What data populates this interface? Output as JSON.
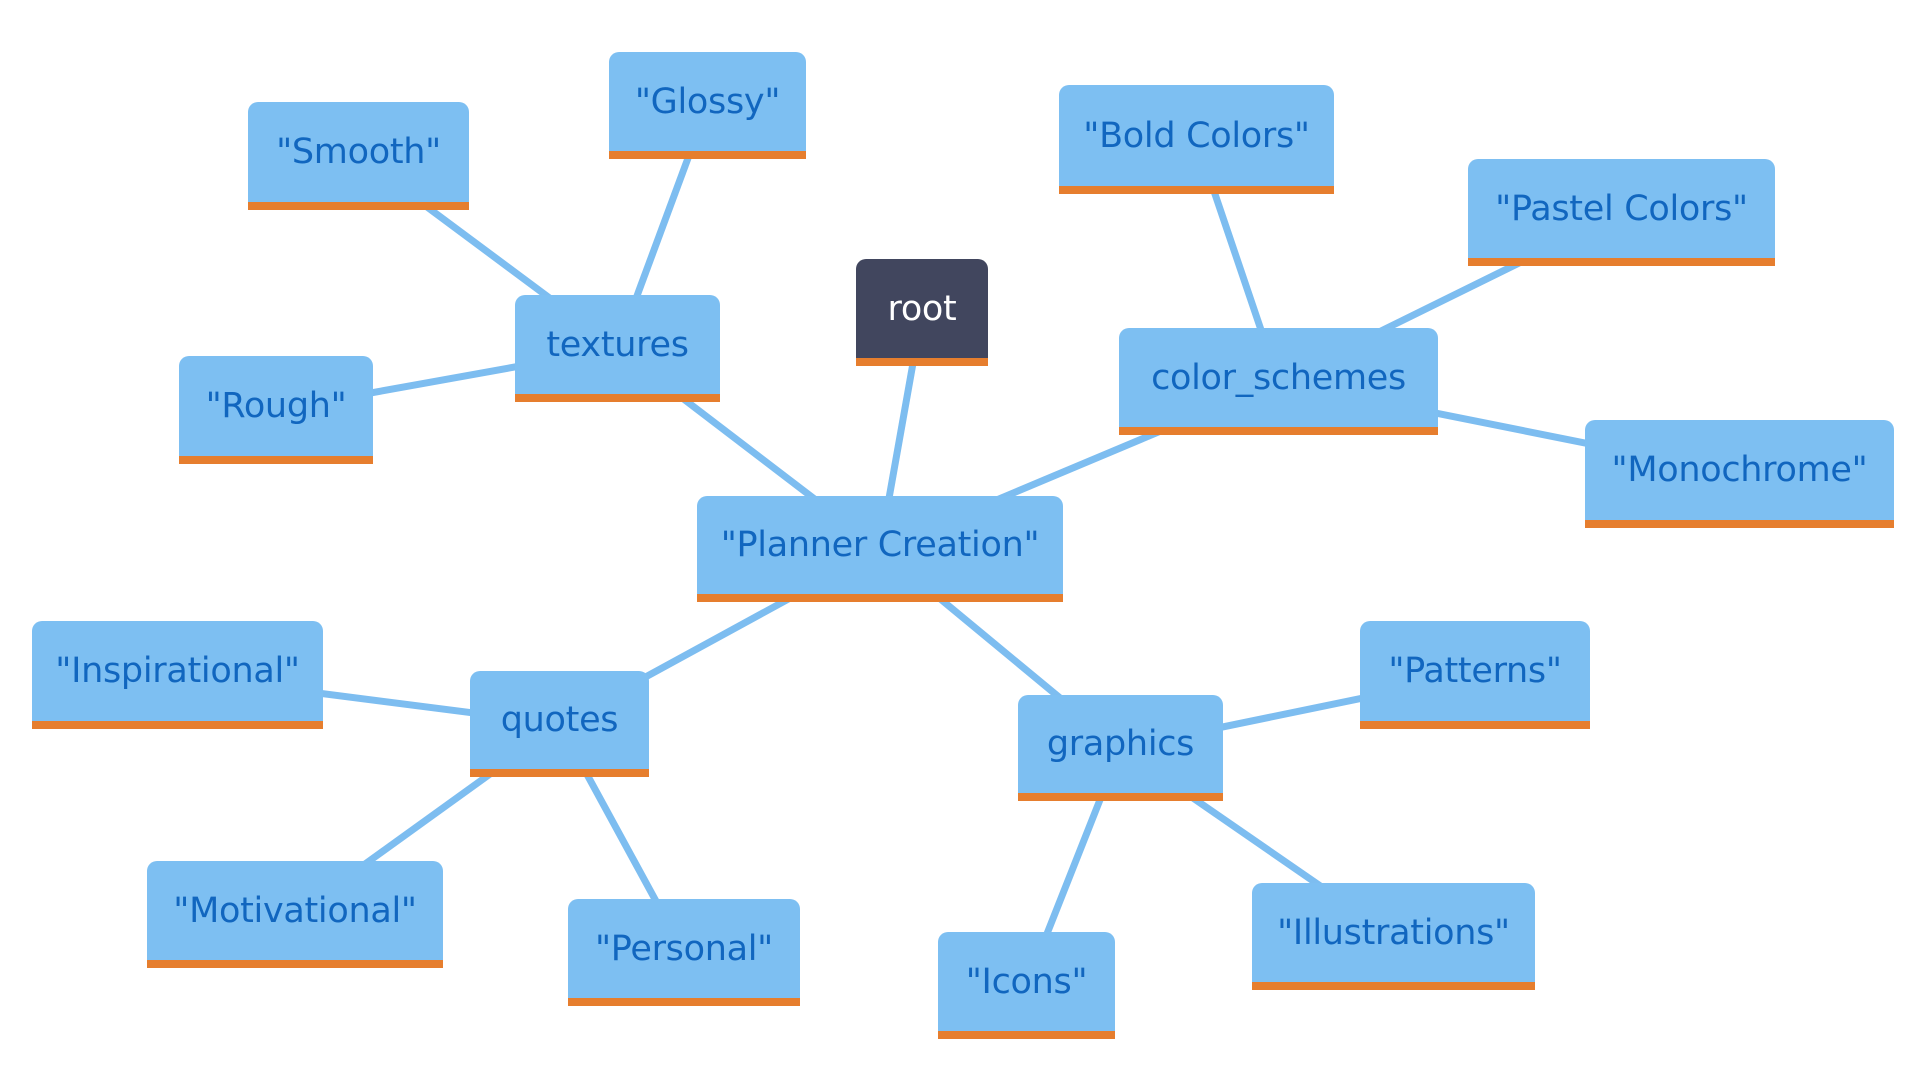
{
  "diagram": {
    "type": "mindmap",
    "colors": {
      "node_fill": "#7dbff2",
      "node_text": "#1166bf",
      "node_underline": "#e67e2e",
      "root_fill": "#41465e",
      "root_text": "#ffffff",
      "edge": "#7dbdf0"
    },
    "nodes": [
      {
        "id": "root",
        "label": "root"
      },
      {
        "id": "planner",
        "label": "\"Planner Creation\""
      },
      {
        "id": "textures",
        "label": "textures"
      },
      {
        "id": "glossy",
        "label": "\"Glossy\""
      },
      {
        "id": "smooth",
        "label": "\"Smooth\""
      },
      {
        "id": "rough",
        "label": "\"Rough\""
      },
      {
        "id": "color_schemes",
        "label": "color_schemes"
      },
      {
        "id": "bold",
        "label": "\"Bold Colors\""
      },
      {
        "id": "pastel",
        "label": "\"Pastel Colors\""
      },
      {
        "id": "mono",
        "label": "\"Monochrome\""
      },
      {
        "id": "quotes",
        "label": "quotes"
      },
      {
        "id": "inspirational",
        "label": "\"Inspirational\""
      },
      {
        "id": "motivational",
        "label": "\"Motivational\""
      },
      {
        "id": "personal",
        "label": "\"Personal\""
      },
      {
        "id": "graphics",
        "label": "graphics"
      },
      {
        "id": "patterns",
        "label": "\"Patterns\""
      },
      {
        "id": "illustrations",
        "label": "\"Illustrations\""
      },
      {
        "id": "icons",
        "label": "\"Icons\""
      }
    ],
    "edges": [
      [
        "root",
        "planner"
      ],
      [
        "planner",
        "textures"
      ],
      [
        "textures",
        "glossy"
      ],
      [
        "textures",
        "smooth"
      ],
      [
        "textures",
        "rough"
      ],
      [
        "planner",
        "color_schemes"
      ],
      [
        "color_schemes",
        "bold"
      ],
      [
        "color_schemes",
        "pastel"
      ],
      [
        "color_schemes",
        "mono"
      ],
      [
        "planner",
        "quotes"
      ],
      [
        "quotes",
        "inspirational"
      ],
      [
        "quotes",
        "motivational"
      ],
      [
        "quotes",
        "personal"
      ],
      [
        "planner",
        "graphics"
      ],
      [
        "graphics",
        "patterns"
      ],
      [
        "graphics",
        "illustrations"
      ],
      [
        "graphics",
        "icons"
      ]
    ]
  }
}
